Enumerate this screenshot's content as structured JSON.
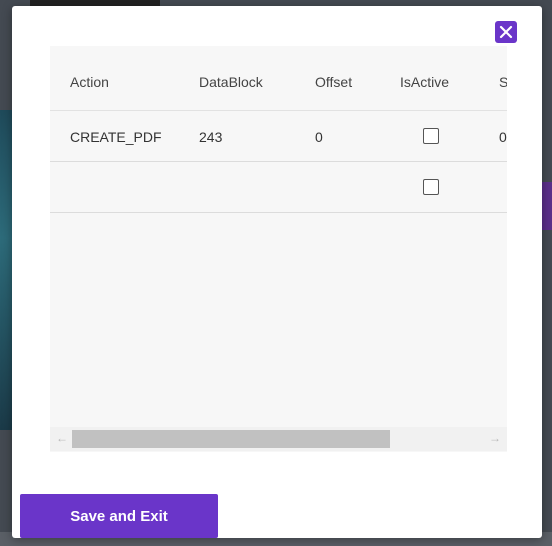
{
  "dialog": {
    "close_icon": "close-icon",
    "save_button_label": "Save and Exit",
    "accent_color": "#6a35c9"
  },
  "grid": {
    "columns": [
      "Action",
      "DataBlock",
      "Offset",
      "IsActive",
      "S"
    ],
    "rows": [
      {
        "action": "CREATE_PDF",
        "datablock": "243",
        "offset": "0",
        "isactive": false,
        "s": "0"
      },
      {
        "action": "",
        "datablock": "",
        "offset": "",
        "isactive": false,
        "s": ""
      }
    ],
    "scroll_left_icon": "arrow-left-icon",
    "scroll_right_icon": "arrow-right-icon"
  }
}
